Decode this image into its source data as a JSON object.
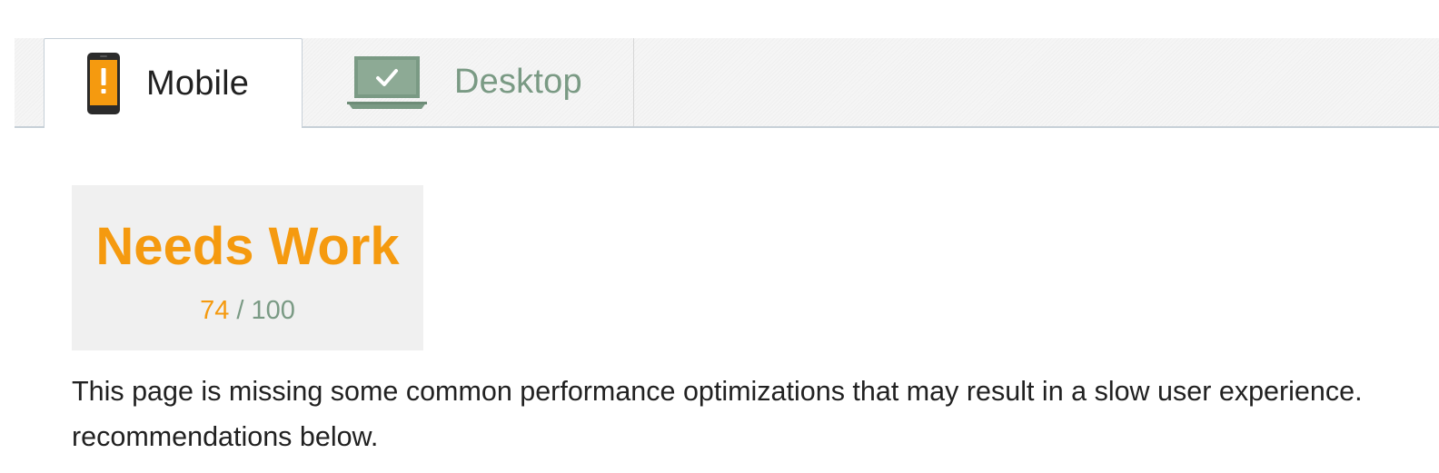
{
  "tabs": {
    "mobile": {
      "label": "Mobile",
      "icon": "mobile-warning-icon",
      "status_color": "#f59a0f",
      "selected": true
    },
    "desktop": {
      "label": "Desktop",
      "icon": "laptop-check-icon",
      "status_color": "#7a9a84",
      "selected": false
    }
  },
  "score": {
    "status": "Needs Work",
    "value": "74",
    "separator": "/",
    "max": "100",
    "status_color": "#f59a0f"
  },
  "description": {
    "line1": "This page is missing some common performance optimizations that may result in a slow user experience.",
    "line2": "recommendations below."
  }
}
